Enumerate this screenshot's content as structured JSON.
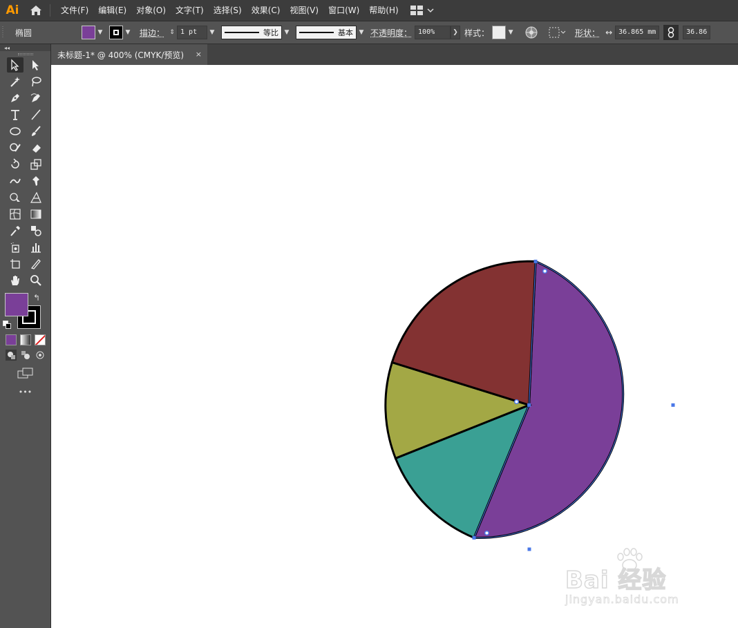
{
  "app": {
    "logo": "Ai",
    "home_icon": "home-icon"
  },
  "menu": [
    "文件(F)",
    "编辑(E)",
    "对象(O)",
    "文字(T)",
    "选择(S)",
    "效果(C)",
    "视图(V)",
    "窗口(W)",
    "帮助(H)"
  ],
  "control": {
    "object_type": "椭圆",
    "fill_color": "#7a3f98",
    "stroke_label": "描边：",
    "stroke_weight": "1 pt",
    "stroke_profile": "等比",
    "brush": "基本",
    "opacity_label": "不透明度：",
    "opacity_value": "100%",
    "style_label": "样式：",
    "shape_label": "形状：",
    "width_value": "36.865 mm",
    "height_value": "36.86"
  },
  "document": {
    "tab_title": "未标题-1* @ 400% (CMYK/预览)",
    "close": "×"
  },
  "tools": {
    "fill_color": "#7a3f98",
    "stroke_color": "#000000",
    "more": "•••"
  },
  "artwork": {
    "slices": [
      {
        "name": "purple",
        "color": "#7a3f98"
      },
      {
        "name": "teal",
        "color": "#3aa094"
      },
      {
        "name": "olive",
        "color": "#a3a845"
      },
      {
        "name": "red",
        "color": "#833232"
      }
    ]
  },
  "watermark": {
    "brand": "Bai 经验",
    "url": "jingyan.baidu.com"
  }
}
